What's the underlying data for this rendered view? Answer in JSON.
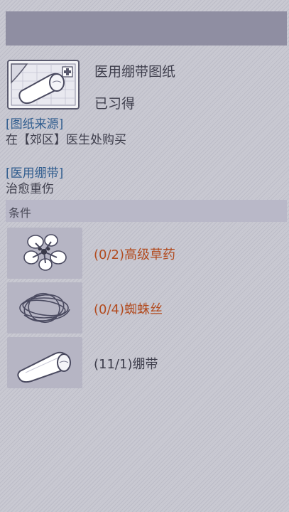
{
  "blueprint": {
    "title": "医用绷带图纸",
    "status": "已习得",
    "icon": "bandage-blueprint-icon"
  },
  "source": {
    "heading": "[图纸来源]",
    "text": "在【郊区】医生处购买"
  },
  "product": {
    "heading": "[医用绷带]",
    "text": "治愈重伤"
  },
  "conditions": {
    "heading": "条件",
    "items": [
      {
        "label": "(0/2)高级草药",
        "icon": "herb-icon",
        "have": 0,
        "need": 2,
        "color": "#b24b1f"
      },
      {
        "label": "(0/4)蜘蛛丝",
        "icon": "spider-silk-icon",
        "have": 0,
        "need": 4,
        "color": "#b24b1f"
      },
      {
        "label": "(11/1)绷带",
        "icon": "bandage-icon",
        "have": 11,
        "need": 1,
        "color": "#3e3e4c"
      }
    ]
  },
  "colors": {
    "accent_heading": "#2f5c8e",
    "lacking": "#b24b1f",
    "panel": "#8f8ea2"
  }
}
